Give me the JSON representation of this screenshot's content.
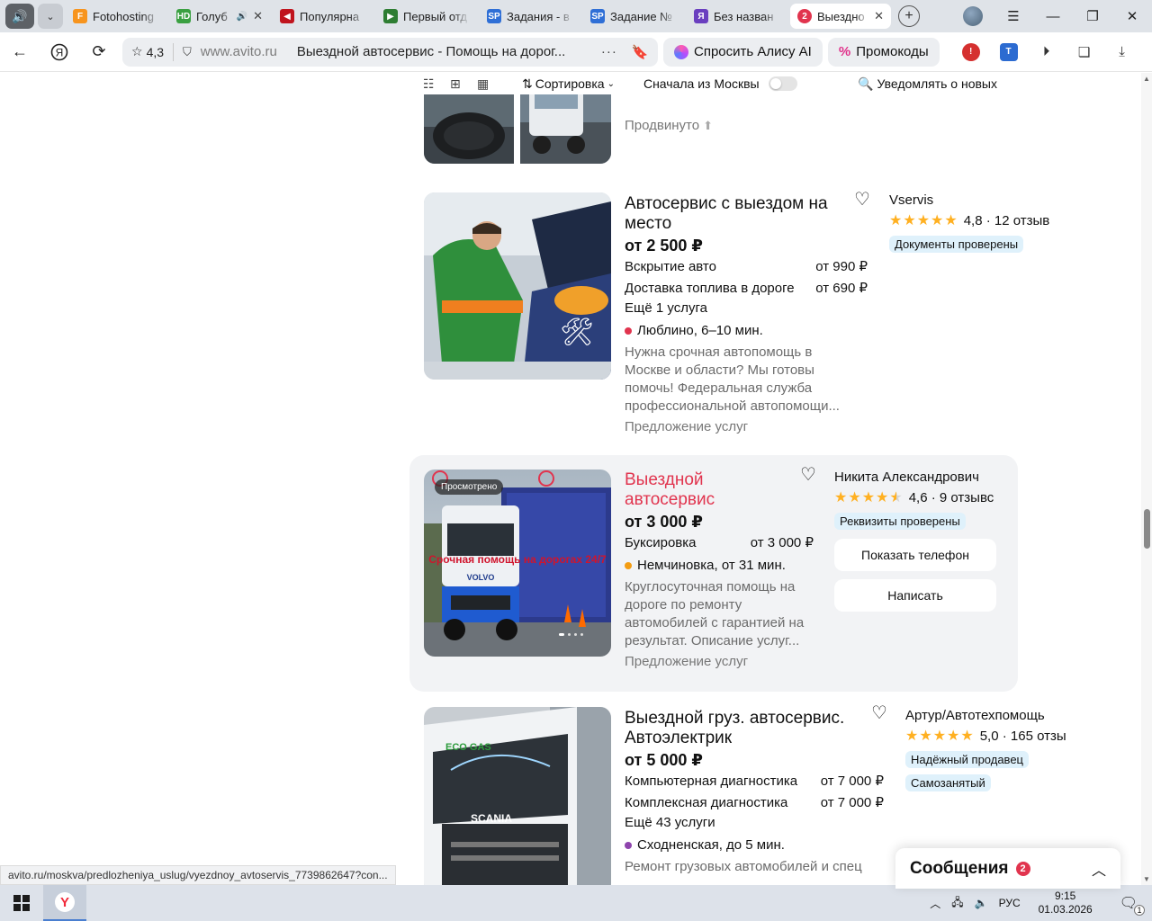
{
  "browser": {
    "tabs": [
      {
        "title": "Fotohosting",
        "fav_text": "F",
        "fav_color": "#f7941d",
        "active": false,
        "sound": false
      },
      {
        "title": "Голуб",
        "fav_text": "HD",
        "fav_color": "#3aa041",
        "active": false,
        "sound": true
      },
      {
        "title": "Популярна",
        "fav_text": "◀",
        "fav_color": "#c0141d",
        "active": false,
        "sound": false
      },
      {
        "title": "Первый отд",
        "fav_text": "▶",
        "fav_color": "#2e7d32",
        "active": false,
        "sound": false
      },
      {
        "title": "Задания - в",
        "fav_text": "SP",
        "fav_color": "#2f6fd6",
        "active": false,
        "sound": false
      },
      {
        "title": "Задание №",
        "fav_text": "SP",
        "fav_color": "#2f6fd6",
        "active": false,
        "sound": false
      },
      {
        "title": "Без назван",
        "fav_text": "Я",
        "fav_color": "#6a3fbf",
        "active": false,
        "sound": false
      },
      {
        "title": "Выездно",
        "fav_text": "2",
        "fav_color": "#e1344e",
        "active": true,
        "sound": false
      }
    ],
    "rating": "4,3",
    "domain": "www.avito.ru",
    "page_title": "Выездной автосервис - Помощь на дорог...",
    "ask_alice": "Спросить Алису AI",
    "promo": "Промокоды",
    "status_url": "avito.ru/moskva/predlozheniya_uslug/vyezdnoy_avtoservis_7739862647?con..."
  },
  "toolbar": {
    "sort_label": "Сортировка",
    "moscow_label": "Сначала из Москвы",
    "notify_label": "Уведомлять о новых"
  },
  "listings": {
    "top_partial": {
      "promoted": "Продвинуто"
    },
    "card1": {
      "title": "Автосервис с выездом на место",
      "price": "от 2 500 ₽",
      "services": [
        {
          "name": "Вскрытие авто",
          "price": "от 990 ₽"
        },
        {
          "name": "Доставка топлива в дороге",
          "price": "от 690 ₽"
        }
      ],
      "more": "Ещё 1 услуга",
      "location": "Люблино, 6–10 мин.",
      "location_color": "#e1344e",
      "description": "Нужна срочная автопомощь в Москве и области? Мы готовы помочь! Федеральная служба профессиональной автопомощи...",
      "category": "Предложение услуг",
      "seller": "Vservis",
      "rating": "4,8 · 12 отзыв",
      "stars": "★★★★★",
      "badges": [
        "Документы проверены"
      ]
    },
    "card2": {
      "viewed_label": "Просмотрено",
      "photo_text": "Срочная помощь на дорогах 24/7",
      "title": "Выездной автосервис",
      "price": "от 3 000 ₽",
      "services": [
        {
          "name": "Буксировка",
          "price": "от 3 000 ₽"
        }
      ],
      "location": "Немчиновка, от 31 мин.",
      "location_color": "#f39c12",
      "description": "Круглосуточная помощь на дороге по ремонту автомобилей с гарантией на результат. Описание услуг...",
      "category": "Предложение услуг",
      "seller": "Никита Александрович",
      "rating": "4,6 · 9 отзывс",
      "stars": "★★★★",
      "half_star": "★",
      "badges": [
        "Реквизиты проверены"
      ],
      "show_phone": "Показать телефон",
      "write": "Написать"
    },
    "card3": {
      "photo_text": "SCANIA",
      "photo_text2": "ECO GAS",
      "title": "Выездной груз. автосервис. Автоэлектрик",
      "price": "от 5 000 ₽",
      "services": [
        {
          "name": "Компьютерная диагностика",
          "price": "от 7 000 ₽"
        },
        {
          "name": "Комплексная диагностика",
          "price": "от 7 000 ₽"
        }
      ],
      "more": "Ещё 43 услуги",
      "location": "Сходненская, до 5 мин.",
      "location_color": "#8e44ad",
      "description": "Ремонт грузовых автомобилей и спец",
      "seller": "Артур/Автотехпомощь",
      "rating": "5,0 · 165 отзы",
      "stars": "★★★★★",
      "badges": [
        "Надёжный продавец",
        "Самозанятый"
      ]
    }
  },
  "messages": {
    "label": "Сообщения",
    "count": "2"
  },
  "taskbar": {
    "lang": "РУС",
    "time": "9:15",
    "date": "01.03.2026",
    "notif_count": "1"
  }
}
